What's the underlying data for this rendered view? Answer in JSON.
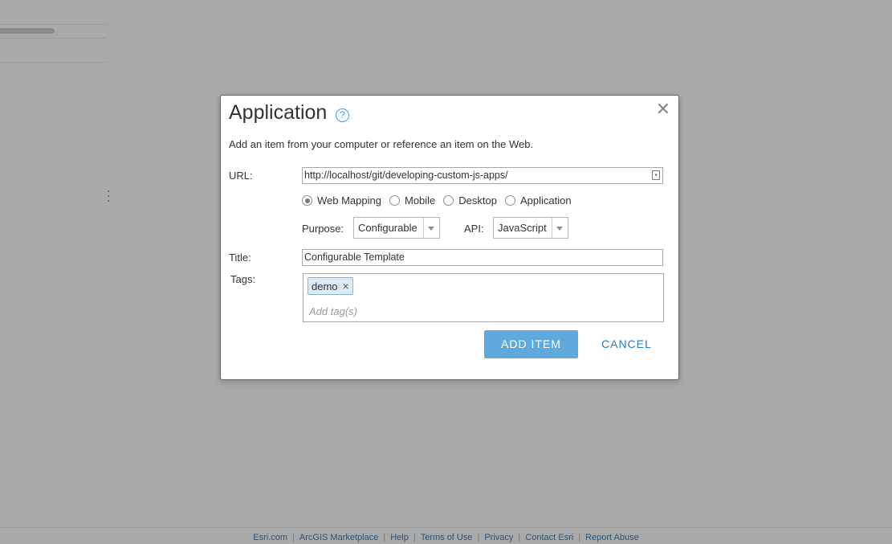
{
  "dialog": {
    "title": "Application",
    "help_icon": "?",
    "close_icon": "✕",
    "description": "Add an item from your computer or reference an item on the Web.",
    "url": {
      "label": "URL:",
      "value": "http://localhost/git/developing-custom-js-apps/"
    },
    "types": [
      {
        "label": "Web Mapping",
        "checked": true
      },
      {
        "label": "Mobile",
        "checked": false
      },
      {
        "label": "Desktop",
        "checked": false
      },
      {
        "label": "Application",
        "checked": false
      }
    ],
    "purpose": {
      "label": "Purpose:",
      "value": "Configurable"
    },
    "api": {
      "label": "API:",
      "value": "JavaScript"
    },
    "title_field": {
      "label": "Title:",
      "value": "Configurable Template"
    },
    "tags": {
      "label": "Tags:",
      "items": [
        "demo"
      ],
      "remove_icon": "×",
      "placeholder": "Add tag(s)"
    },
    "add_button": "ADD ITEM",
    "cancel_button": "CANCEL"
  },
  "footer": {
    "links": [
      "Esri.com",
      "ArcGIS Marketplace",
      "Help",
      "Terms of Use",
      "Privacy",
      "Contact Esri",
      "Report Abuse"
    ],
    "separator": "|"
  },
  "colors": {
    "overlay": "#a9a9a9",
    "primary_button": "#5fa9dc",
    "link": "#2a7ab8"
  }
}
